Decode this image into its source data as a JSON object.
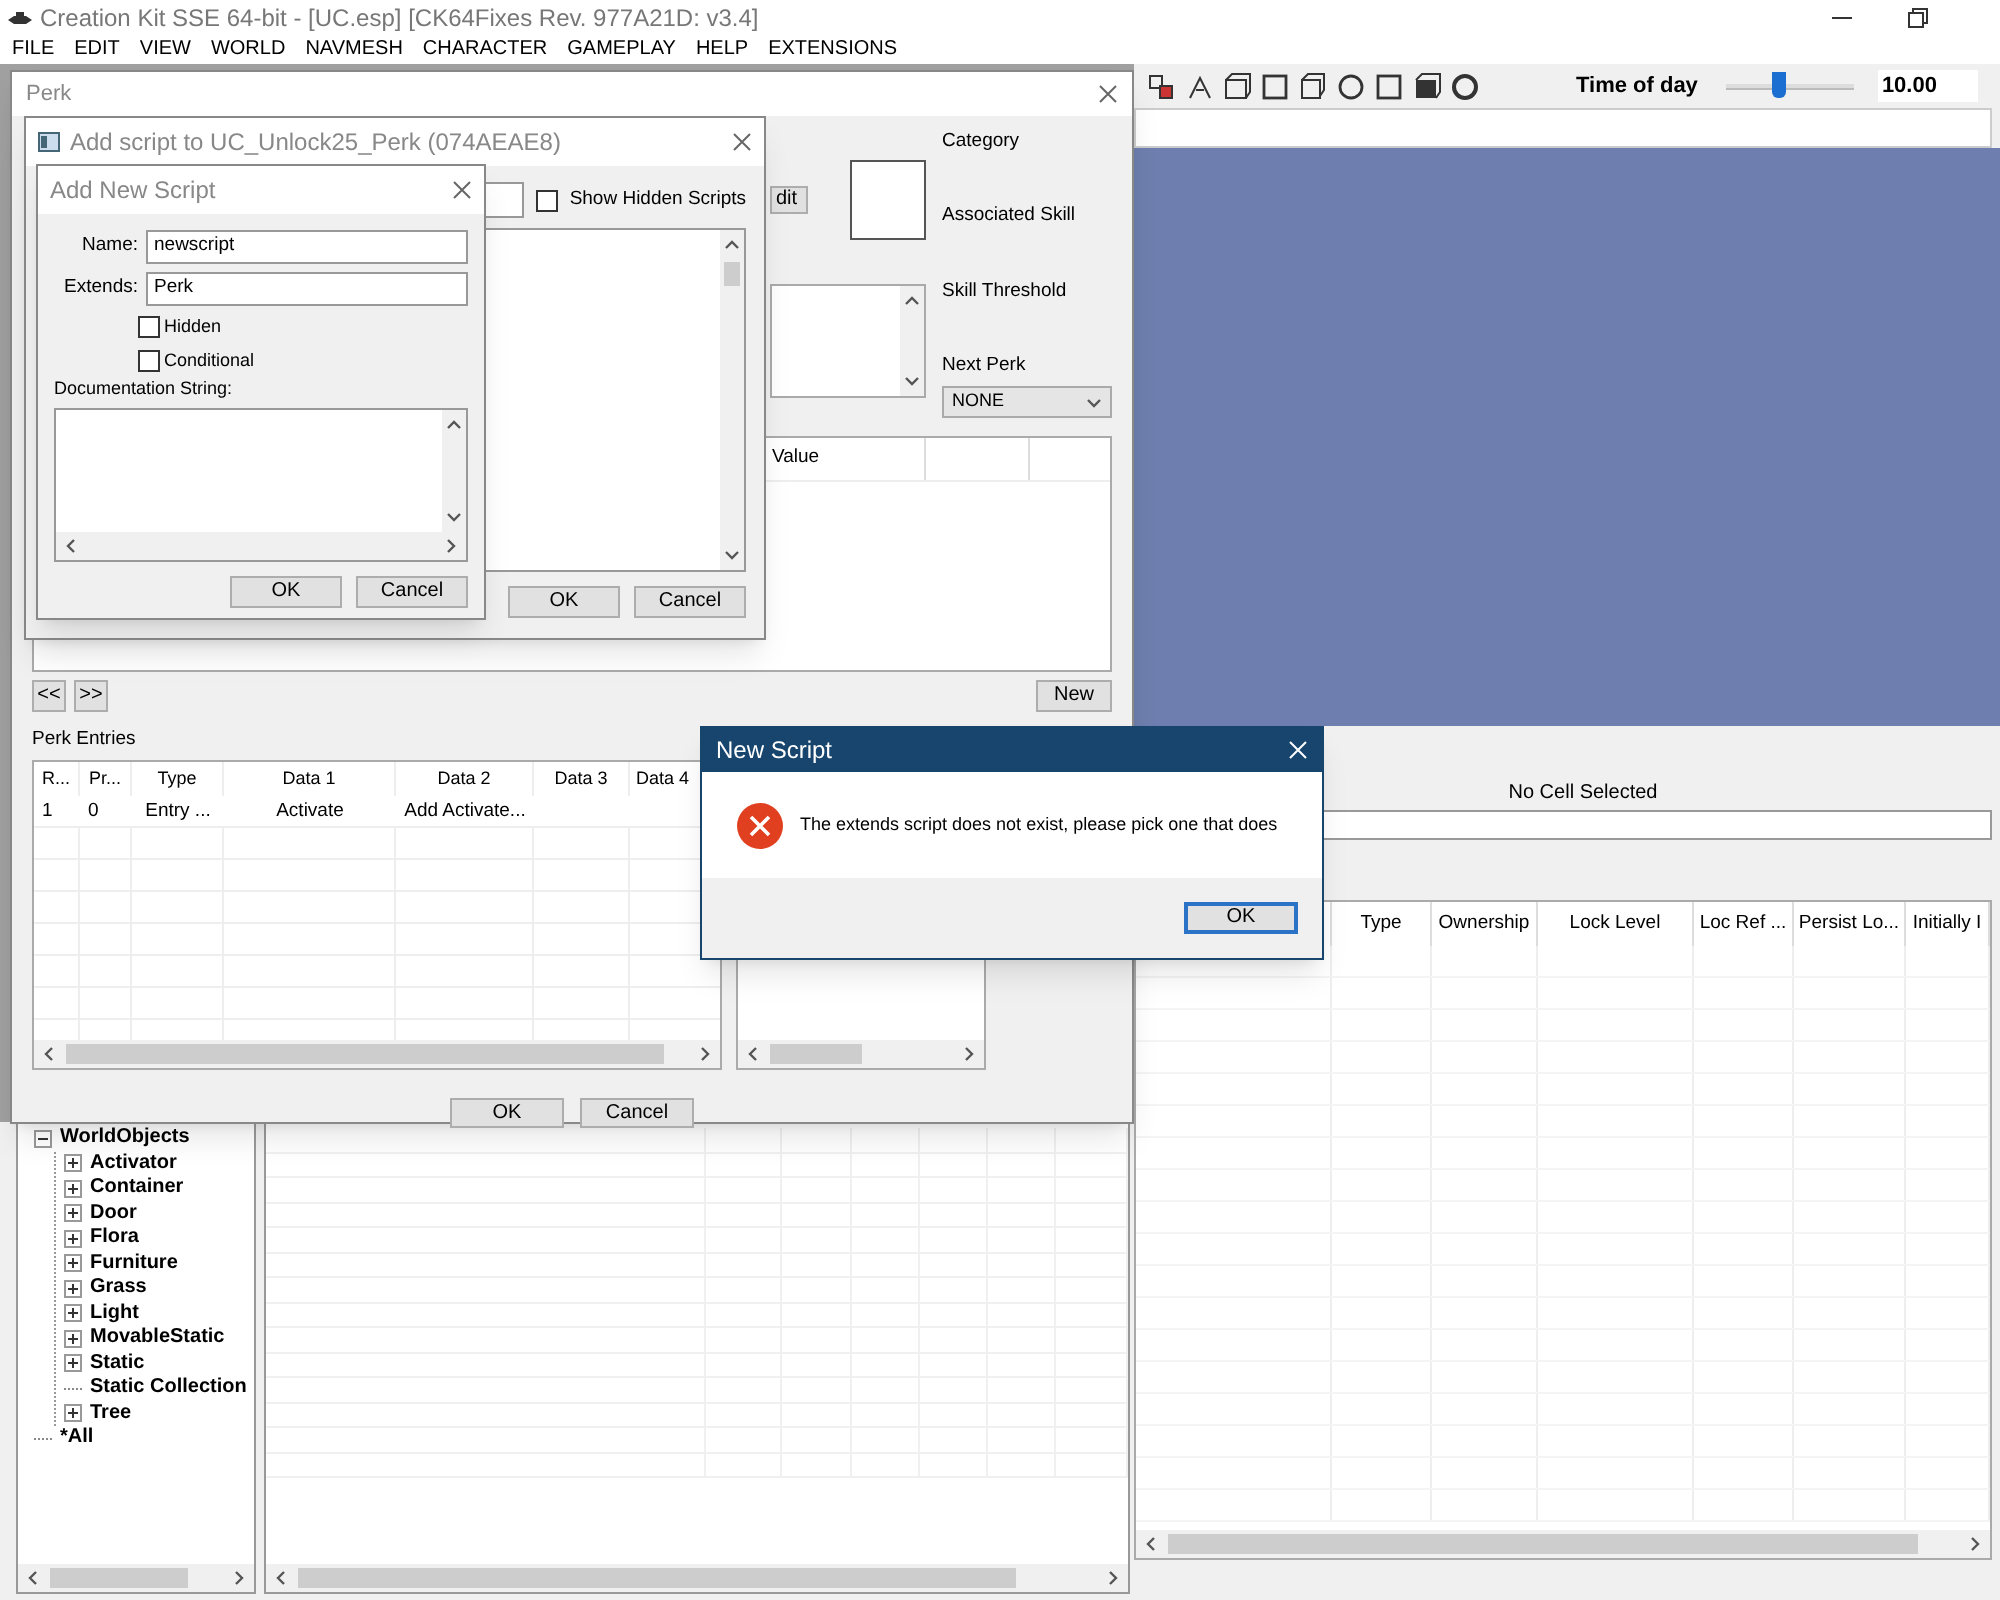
{
  "app": {
    "title": "Creation Kit SSE 64-bit - [UC.esp] [CK64Fixes Rev. 977A21D: v3.4]",
    "menu": [
      "FILE",
      "EDIT",
      "VIEW",
      "WORLD",
      "NAVMESH",
      "CHARACTER",
      "GAMEPLAY",
      "HELP",
      "EXTENSIONS"
    ]
  },
  "toolbar": {
    "time_label": "Time of day",
    "time": {
      "level": 0.42
    },
    "time_value": "10.00"
  },
  "cell_view": {
    "status": "No Cell Selected",
    "columns": [
      "Type",
      "Ownership",
      "Lock Level",
      "Loc Ref ...",
      "Persist Lo...",
      "Initially I"
    ]
  },
  "object_tree": [
    {
      "label": "WorldObjects",
      "expanded": true,
      "children": [
        {
          "label": "Activator",
          "expandable": true
        },
        {
          "label": "Container",
          "expandable": true
        },
        {
          "label": "Door",
          "expandable": true
        },
        {
          "label": "Flora",
          "expandable": true
        },
        {
          "label": "Furniture",
          "expandable": true
        },
        {
          "label": "Grass",
          "expandable": true
        },
        {
          "label": "Light",
          "expandable": true
        },
        {
          "label": "MovableStatic",
          "expandable": true
        },
        {
          "label": "Static",
          "expandable": true
        },
        {
          "label": "Static Collection",
          "expandable": false
        },
        {
          "label": "Tree",
          "expandable": true
        }
      ]
    },
    {
      "label": "*All",
      "expandable": false
    }
  ],
  "perk": {
    "title": "Perk",
    "edit_button": "dit",
    "category_label": "Category",
    "skill_label": "Associated Skill",
    "threshold_label": "Skill Threshold",
    "next_perk_label": "Next Perk",
    "next_perk": "NONE",
    "conditions_header": "Value",
    "nav": [
      "<<",
      ">>"
    ],
    "new_button": "New",
    "entries_label": "Perk Entries",
    "entries_columns": [
      "R...",
      "Pr...",
      "Type",
      "Data 1",
      "Data 2",
      "Data 3",
      "Data 4"
    ],
    "entries_rows": [
      [
        "1",
        "0",
        "Entry ...",
        "Activate",
        "Add Activate..."
      ]
    ],
    "buttons": [
      "OK",
      "Cancel"
    ]
  },
  "add_script": {
    "title": "Add script to UC_Unlock25_Perk (074AEAE8)",
    "show_hidden": {
      "label": "Show Hidden Scripts",
      "checked": false
    },
    "buttons": [
      "OK",
      "Cancel"
    ]
  },
  "new_script_form": {
    "title": "Add New Script",
    "name_label": "Name:",
    "name": "newscript",
    "extends_label": "Extends:",
    "extends": "Perk",
    "options": [
      {
        "label": "Hidden",
        "checked": false
      },
      {
        "label": "Conditional",
        "checked": false
      }
    ],
    "doc_label": "Documentation String:",
    "buttons": [
      "OK",
      "Cancel"
    ]
  },
  "message": {
    "title": "New Script",
    "text": "The extends script does not exist, please pick one that does",
    "button": "OK"
  }
}
